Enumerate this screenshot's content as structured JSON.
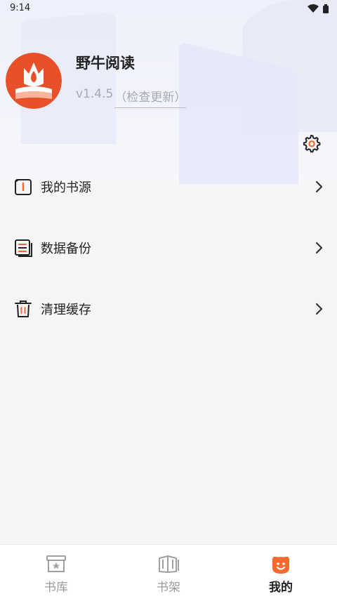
{
  "status_bar": {
    "time": "9:14"
  },
  "profile": {
    "app_name": "野牛阅读",
    "version": "v1.4.5",
    "check_update": "（检查更新）"
  },
  "menu": [
    {
      "label": "我的书源",
      "icon": "book-source-icon"
    },
    {
      "label": "数据备份",
      "icon": "backup-icon"
    },
    {
      "label": "清理缓存",
      "icon": "trash-icon"
    }
  ],
  "bottom_nav": [
    {
      "label": "书库",
      "icon": "library-icon",
      "active": false
    },
    {
      "label": "书架",
      "icon": "bookshelf-icon",
      "active": false
    },
    {
      "label": "我的",
      "icon": "mine-icon",
      "active": true
    }
  ],
  "colors": {
    "accent": "#f26a2d",
    "text": "#222222",
    "muted": "#9a9a9a",
    "background": "#f5f5f5"
  }
}
